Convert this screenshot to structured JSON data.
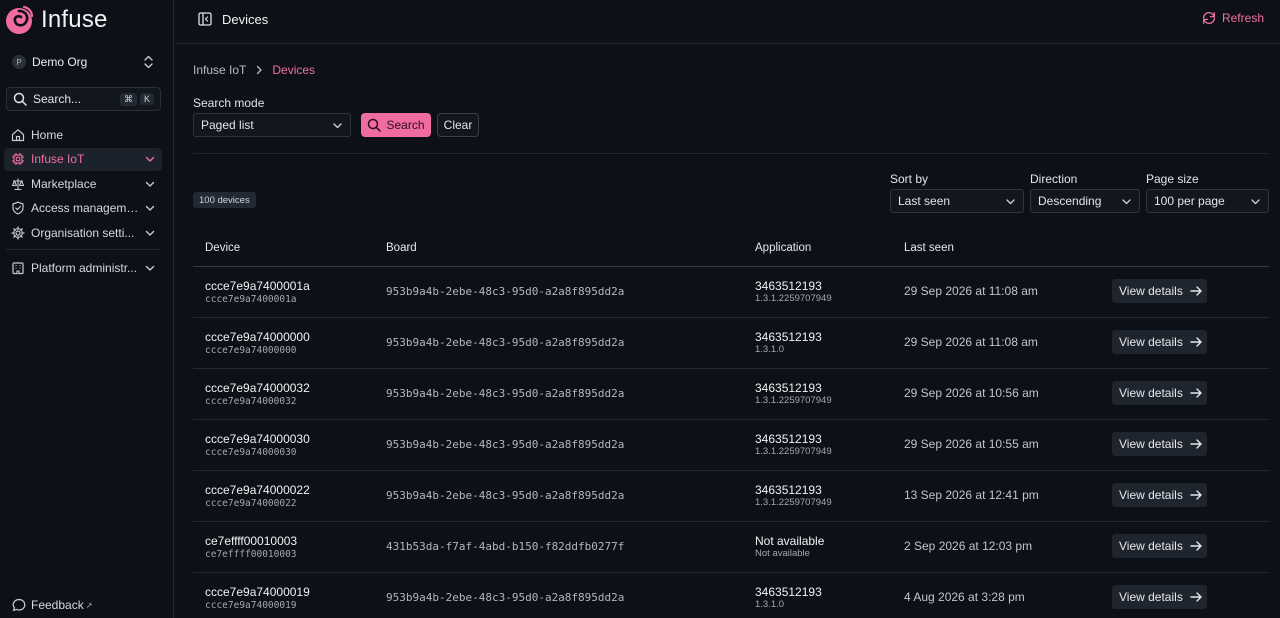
{
  "brand": {
    "name": "Infuse",
    "accent": "#f06ba2"
  },
  "org": {
    "initial": "P",
    "name": "Demo Org"
  },
  "search": {
    "placeholder": "Search...",
    "shortcut_mod": "⌘",
    "shortcut_key": "K"
  },
  "nav": {
    "items": [
      {
        "label": "Home",
        "icon": "home-icon"
      },
      {
        "label": "Infuse IoT",
        "icon": "chip-icon",
        "active": true
      },
      {
        "label": "Marketplace",
        "icon": "scale-icon"
      },
      {
        "label": "Access manageme...",
        "icon": "shield-icon"
      },
      {
        "label": "Organisation setti...",
        "icon": "gear-icon"
      }
    ],
    "platform": {
      "label": "Platform administr...",
      "icon": "building-icon"
    }
  },
  "feedback": {
    "label": "Feedback"
  },
  "topbar": {
    "title": "Devices",
    "refresh_label": "Refresh"
  },
  "breadcrumb": {
    "root": "Infuse IoT",
    "current": "Devices"
  },
  "search_mode": {
    "label": "Search mode",
    "value": "Paged list",
    "search_button": "Search",
    "clear_button": "Clear"
  },
  "sort": {
    "sort_by_label": "Sort by",
    "sort_by_value": "Last seen",
    "direction_label": "Direction",
    "direction_value": "Descending",
    "page_size_label": "Page size",
    "page_size_value": "100 per page"
  },
  "count_badge": "100 devices",
  "table": {
    "headers": {
      "device": "Device",
      "board": "Board",
      "application": "Application",
      "last_seen": "Last seen"
    },
    "view_label": "View details",
    "rows": [
      {
        "name": "ccce7e9a7400001a",
        "id": "ccce7e9a7400001a",
        "board": "953b9a4b-2ebe-48c3-95d0-a2a8f895dd2a",
        "app": "3463512193",
        "version": "1.3.1.2259707949",
        "seen": "29 Sep 2026 at 11:08 am"
      },
      {
        "name": "ccce7e9a74000000",
        "id": "ccce7e9a74000000",
        "board": "953b9a4b-2ebe-48c3-95d0-a2a8f895dd2a",
        "app": "3463512193",
        "version": "1.3.1.0",
        "seen": "29 Sep 2026 at 11:08 am"
      },
      {
        "name": "ccce7e9a74000032",
        "id": "ccce7e9a74000032",
        "board": "953b9a4b-2ebe-48c3-95d0-a2a8f895dd2a",
        "app": "3463512193",
        "version": "1.3.1.2259707949",
        "seen": "29 Sep 2026 at 10:56 am"
      },
      {
        "name": "ccce7e9a74000030",
        "id": "ccce7e9a74000030",
        "board": "953b9a4b-2ebe-48c3-95d0-a2a8f895dd2a",
        "app": "3463512193",
        "version": "1.3.1.2259707949",
        "seen": "29 Sep 2026 at 10:55 am"
      },
      {
        "name": "ccce7e9a74000022",
        "id": "ccce7e9a74000022",
        "board": "953b9a4b-2ebe-48c3-95d0-a2a8f895dd2a",
        "app": "3463512193",
        "version": "1.3.1.2259707949",
        "seen": "13 Sep 2026 at 12:41 pm"
      },
      {
        "name": "ce7effff00010003",
        "id": "ce7effff00010003",
        "board": "431b53da-f7af-4abd-b150-f82ddfb0277f",
        "app": "Not available",
        "version": "Not available",
        "seen": "2 Sep 2026 at 12:03 pm"
      },
      {
        "name": "ccce7e9a74000019",
        "id": "ccce7e9a74000019",
        "board": "953b9a4b-2ebe-48c3-95d0-a2a8f895dd2a",
        "app": "3463512193",
        "version": "1.3.1.0",
        "seen": "4 Aug 2026 at 3:28 pm"
      }
    ]
  }
}
